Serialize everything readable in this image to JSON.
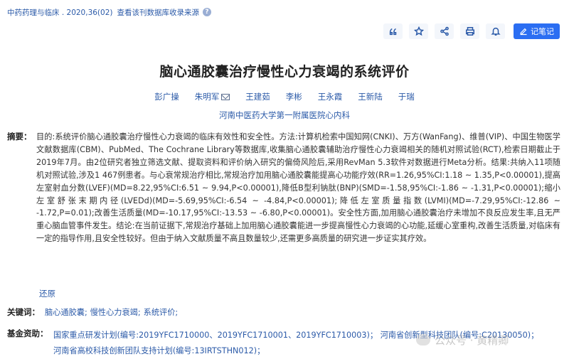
{
  "header": {
    "journal": "中药药理与临床 . 2020,36(02)",
    "source_link": "查看该刊数据库收录来源",
    "help_glyph": "?"
  },
  "toolbar": {
    "note_label": "记笔记",
    "icons": [
      "quote-icon",
      "star-icon",
      "share-icon",
      "print-icon",
      "bell-icon",
      "edit-icon"
    ]
  },
  "article": {
    "title": "脑心通胶囊治疗慢性心力衰竭的系统评价",
    "authors": [
      "彭广操",
      "朱明军",
      "王建茹",
      "李彬",
      "王永霞",
      "王新陆",
      "于瑞"
    ],
    "affiliation": "河南中医药大学第一附属医院心内科",
    "abstract_label": "摘要：",
    "abstract": "目的:系统评价脑心通胶囊治疗慢性心力衰竭的临床有效性和安全性。方法:计算机检索中国知网(CNKI)、万方(WanFang)、维普(VIP)、中国生物医学文献数据库(CBM)、PubMed、The Cochrane Library等数据库,收集脑心通胶囊辅助治疗慢性心力衰竭相关的随机对照试验(RCT),检索日期截止于2019年7月。由2位研究者独立筛选文献、提取资料和评价纳入研究的偏倚风险后,采用RevMan 5.3软件对数据进行Meta分析。结果:共纳入11项随机对照试验,涉及1 467例患者。与心衰常规治疗相比,常规治疗加用脑心通胶囊能提高心功能疗效(RR=1.26,95%CI:1.18 ~ 1.35,P<0.00001),提高左室射血分数(LVEF)(MD=8.22,95%CI:6.51 ~ 9.94,P<0.00001),降低B型利钠肽(BNP)(SMD=-1.58,95%CI:-1.86 ~ -1.31,P<0.00001);缩小左室舒张末期内径(LVEDd)(MD=-5.69,95%CI:-6.54 ~ -4.84,P<0.00001);降低左室质量指数(LVMI)(MD=-7.29,95%CI:-12.86 ~ -1.72,P=0.01);改善生活质量(MD=-10.17,95%CI:-13.53 ~ -6.80,P<0.00001)。安全性方面,加用脑心通胶囊治疗未增加不良反应发生率,且无严重心脑血管事件发生。结论:在当前证据下,常规治疗基础上加用脑心通胶囊能进一步提高慢性心力衰竭的心功能,延缓心室重构,改善生活质量,对临床有一定的指导作用,且安全性较好。但由于纳入文献质量不高且数量较少,还需更多高质量的研究进一步证实其疗效。",
    "restore_label": "还原",
    "keywords_label": "关键词：",
    "keywords": [
      "脑心通胶囊;",
      "慢性心力衰竭;",
      "系统评价;"
    ],
    "funding_label": "基金资助：",
    "funding_line1": "国家重点研发计划(编号:2019YFC1710000、2019YFC1710001、2019YFC1710003)；  河南省创新型科技团队(编号:C20130050)；",
    "funding_line2": "河南省高校科技创新团队支持计划(编号:13IRTSTHN012)；"
  },
  "watermark": {
    "text": "公众号 · 黄精卿"
  }
}
